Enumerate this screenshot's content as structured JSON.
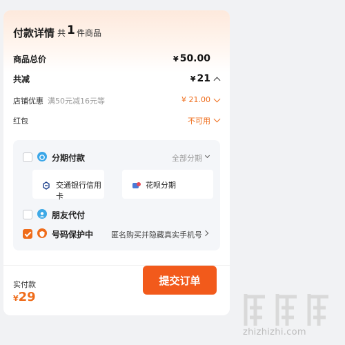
{
  "header": {
    "title": "付款详情",
    "count_prefix": "共",
    "count": "1",
    "count_suffix": "件商品"
  },
  "summary": {
    "total_label": "商品总价",
    "total_currency": "¥",
    "total_value": "50.00",
    "discount_label": "共减",
    "discount_currency": "¥",
    "discount_value": "21",
    "store_label": "店铺优惠",
    "store_note": "满50元减16元等",
    "store_value": "¥ 21.00",
    "redpacket_label": "红包",
    "redpacket_value": "不可用"
  },
  "payment": {
    "installment": {
      "label": "分期付款",
      "action": "全部分期",
      "checked": false,
      "options": [
        {
          "label": "交通银行信用卡",
          "icon": "bocom-logo-icon"
        },
        {
          "label": "花呗分期",
          "icon": "huabei-icon"
        }
      ]
    },
    "friend_pay": {
      "label": "朋友代付",
      "checked": false
    },
    "number_protect": {
      "label": "号码保护中",
      "note": "匿名购买并隐藏真实手机号",
      "checked": true
    }
  },
  "footer": {
    "paid_label": "实付款",
    "paid_currency": "¥",
    "paid_value": "29",
    "submit_label": "提交订单"
  },
  "watermark": {
    "url_text": "zhizhizhi.com"
  },
  "colors": {
    "accent": "#ef6c1a",
    "button": "#f25a1b",
    "panel": "#f4f6f9"
  }
}
